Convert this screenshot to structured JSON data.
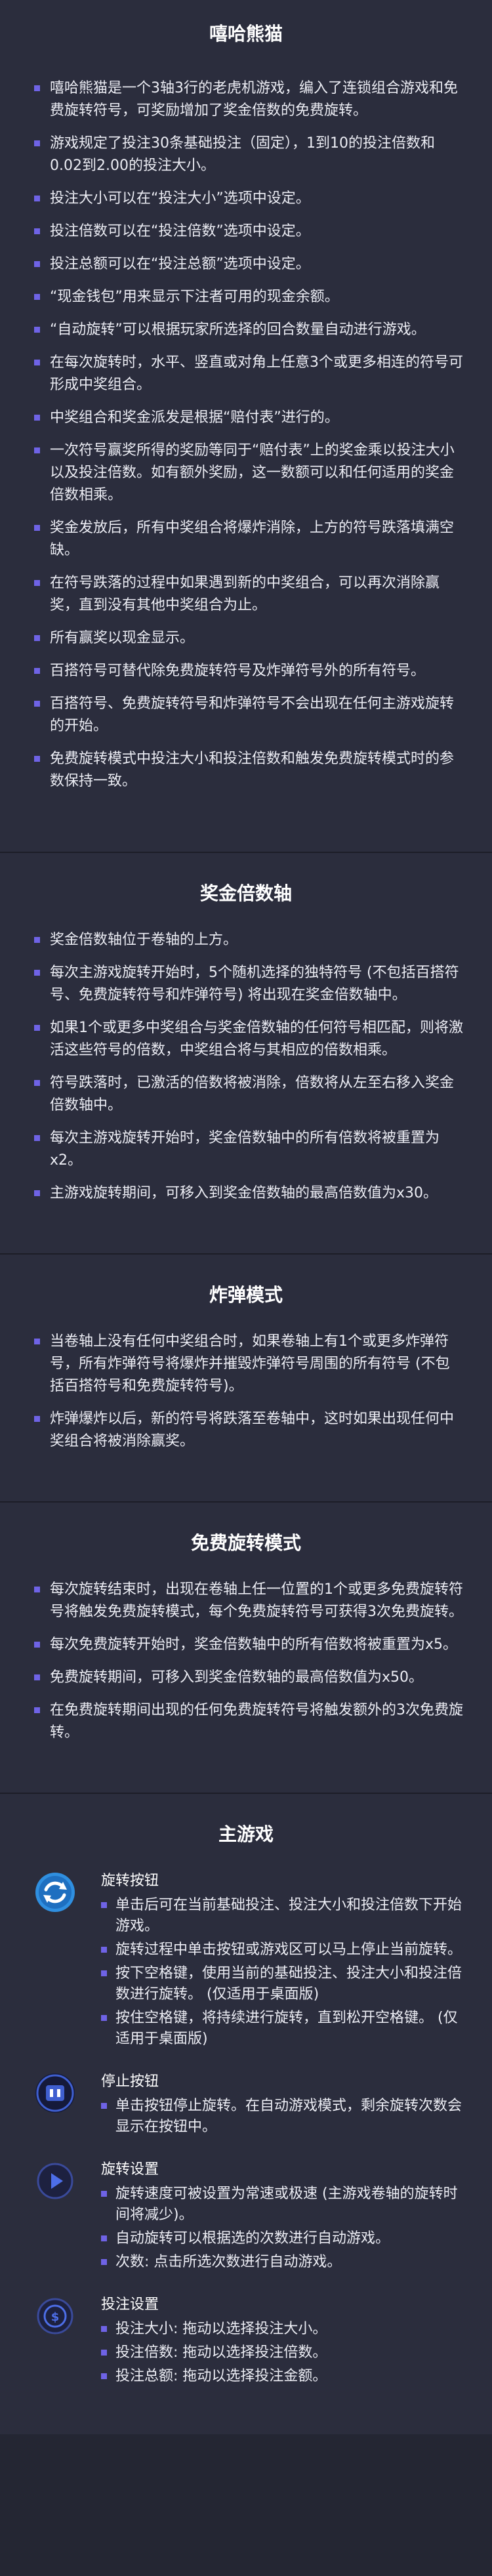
{
  "sections": [
    {
      "title": "嘻哈熊猫",
      "items": [
        "嘻哈熊猫是一个3轴3行的老虎机游戏，编入了连锁组合游戏和免费旋转符号，可奖励增加了奖金倍数的免费旋转。",
        "游戏规定了投注30条基础投注（固定），1到10的投注倍数和0.02到2.00的投注大小。",
        "投注大小可以在“投注大小”选项中设定。",
        "投注倍数可以在“投注倍数”选项中设定。",
        "投注总额可以在“投注总额”选项中设定。",
        "“现金钱包”用来显示下注者可用的现金余额。",
        "“自动旋转”可以根据玩家所选择的回合数量自动进行游戏。",
        "在每次旋转时，水平、竖直或对角上任意3个或更多相连的符号可形成中奖组合。",
        "中奖组合和奖金派发是根据“赔付表”进行的。",
        "一次符号赢奖所得的奖励等同于“赔付表”上的奖金乘以投注大小以及投注倍数。如有额外奖励，这一数额可以和任何适用的奖金倍数相乘。",
        "奖金发放后，所有中奖组合将爆炸消除，上方的符号跌落填满空缺。",
        "在符号跌落的过程中如果遇到新的中奖组合，可以再次消除赢奖，直到没有其他中奖组合为止。",
        "所有赢奖以现金显示。",
        "百搭符号可替代除免费旋转符号及炸弹符号外的所有符号。",
        "百搭符号、免费旋转符号和炸弹符号不会出现在任何主游戏旋转的开始。",
        "免费旋转模式中投注大小和投注倍数和触发免费旋转模式时的参数保持一致。"
      ]
    },
    {
      "title": "奖金倍数轴",
      "items": [
        "奖金倍数轴位于卷轴的上方。",
        "每次主游戏旋转开始时，5个随机选择的独特符号 (不包括百搭符号、免费旋转符号和炸弹符号) 将出现在奖金倍数轴中。",
        "如果1个或更多中奖组合与奖金倍数轴的任何符号相匹配，则将激活这些符号的倍数，中奖组合将与其相应的倍数相乘。",
        "符号跌落时，已激活的倍数将被消除，倍数将从左至右移入奖金倍数轴中。",
        "每次主游戏旋转开始时，奖金倍数轴中的所有倍数将被重置为x2。",
        "主游戏旋转期间，可移入到奖金倍数轴的最高倍数值为x30。"
      ]
    },
    {
      "title": "炸弹模式",
      "items": [
        "当卷轴上没有任何中奖组合时，如果卷轴上有1个或更多炸弹符号，所有炸弹符号将爆炸并摧毁炸弹符号周围的所有符号 (不包括百搭符号和免费旋转符号)。",
        "炸弹爆炸以后，新的符号将跌落至卷轴中，这时如果出现任何中奖组合将被消除赢奖。"
      ]
    },
    {
      "title": "免费旋转模式",
      "items": [
        "每次旋转结束时，出现在卷轴上任一位置的1个或更多免费旋转符号将触发免费旋转模式，每个免费旋转符号可获得3次免费旋转。",
        "每次免费旋转开始时，奖金倍数轴中的所有倍数将被重置为x5。",
        "免费旋转期间，可移入到奖金倍数轴的最高倍数值为x50。",
        "在免费旋转期间出现的任何免费旋转符号将触发额外的3次免费旋转。"
      ]
    }
  ],
  "main_game": {
    "title": "主游戏",
    "buttons": [
      {
        "icon": "spin-icon",
        "title": "旋转按钮",
        "items": [
          "单击后可在当前基础投注、投注大小和投注倍数下开始游戏。",
          "旋转过程中单击按钮或游戏区可以马上停止当前旋转。",
          "按下空格键，使用当前的基础投注、投注大小和投注倍数进行旋转。 (仅适用于桌面版)",
          "按住空格键，将持续进行旋转，直到松开空格键。 (仅适用于桌面版)"
        ]
      },
      {
        "icon": "stop-icon",
        "title": "停止按钮",
        "items": [
          "单击按钮停止旋转。在自动游戏模式，剩余旋转次数会显示在按钮中。"
        ]
      },
      {
        "icon": "spin-settings-icon",
        "title": "旋转设置",
        "items": [
          "旋转速度可被设置为常速或极速 (主游戏卷轴的旋转时间将减少)。",
          "自动旋转可以根据选的次数进行自动游戏。",
          "次数: 点击所选次数进行自动游戏。"
        ]
      },
      {
        "icon": "bet-settings-icon",
        "title": "投注设置",
        "items": [
          "投注大小: 拖动以选择投注大小。",
          "投注倍数: 拖动以选择投注倍数。",
          "投注总额: 拖动以选择投注金额。"
        ]
      }
    ]
  },
  "colors": {
    "background": "#242633",
    "section": "#2b2d3d",
    "bullet": "#6f63e6",
    "spin_icon": "#2f8fe0",
    "stop_icon": "#3f5fd0"
  }
}
